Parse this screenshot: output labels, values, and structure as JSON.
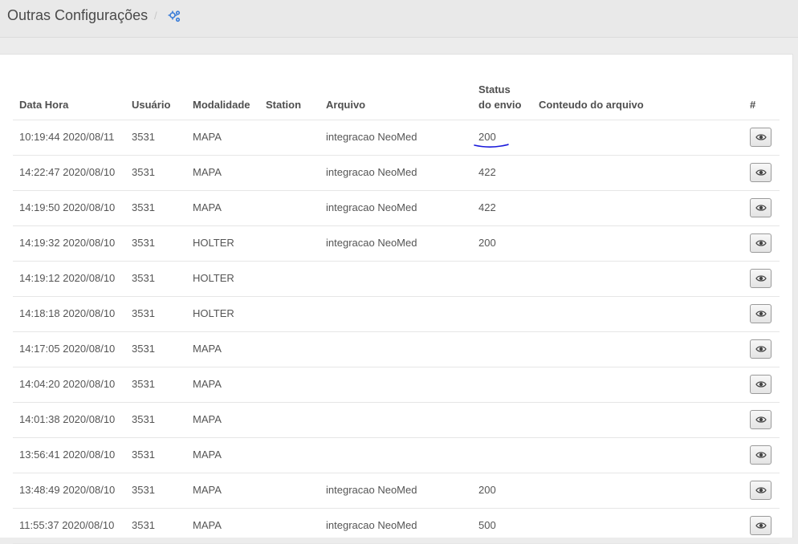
{
  "header": {
    "title": "Outras Configurações",
    "separator": "/",
    "icon": "cogs-icon"
  },
  "table": {
    "columns": {
      "data_hora": "Data Hora",
      "usuario": "Usuário",
      "modalidade": "Modalidade",
      "station": "Station",
      "arquivo": "Arquivo",
      "status_line1": "Status",
      "status_line2": "do envio",
      "conteudo": "Conteudo do arquivo",
      "acao": "#"
    },
    "rows": [
      {
        "data_hora": "10:19:44 2020/08/11",
        "usuario": "3531",
        "modalidade": "MAPA",
        "station": "",
        "arquivo": "integracao NeoMed",
        "status": "200",
        "conteudo": ""
      },
      {
        "data_hora": "14:22:47 2020/08/10",
        "usuario": "3531",
        "modalidade": "MAPA",
        "station": "",
        "arquivo": "integracao NeoMed",
        "status": "422",
        "conteudo": ""
      },
      {
        "data_hora": "14:19:50 2020/08/10",
        "usuario": "3531",
        "modalidade": "MAPA",
        "station": "",
        "arquivo": "integracao NeoMed",
        "status": "422",
        "conteudo": ""
      },
      {
        "data_hora": "14:19:32 2020/08/10",
        "usuario": "3531",
        "modalidade": "HOLTER",
        "station": "",
        "arquivo": "integracao NeoMed",
        "status": "200",
        "conteudo": ""
      },
      {
        "data_hora": "14:19:12 2020/08/10",
        "usuario": "3531",
        "modalidade": "HOLTER",
        "station": "",
        "arquivo": "",
        "status": "",
        "conteudo": ""
      },
      {
        "data_hora": "14:18:18 2020/08/10",
        "usuario": "3531",
        "modalidade": "HOLTER",
        "station": "",
        "arquivo": "",
        "status": "",
        "conteudo": ""
      },
      {
        "data_hora": "14:17:05 2020/08/10",
        "usuario": "3531",
        "modalidade": "MAPA",
        "station": "",
        "arquivo": "",
        "status": "",
        "conteudo": ""
      },
      {
        "data_hora": "14:04:20 2020/08/10",
        "usuario": "3531",
        "modalidade": "MAPA",
        "station": "",
        "arquivo": "",
        "status": "",
        "conteudo": ""
      },
      {
        "data_hora": "14:01:38 2020/08/10",
        "usuario": "3531",
        "modalidade": "MAPA",
        "station": "",
        "arquivo": "",
        "status": "",
        "conteudo": ""
      },
      {
        "data_hora": "13:56:41 2020/08/10",
        "usuario": "3531",
        "modalidade": "MAPA",
        "station": "",
        "arquivo": "",
        "status": "",
        "conteudo": ""
      },
      {
        "data_hora": "13:48:49 2020/08/10",
        "usuario": "3531",
        "modalidade": "MAPA",
        "station": "",
        "arquivo": "integracao NeoMed",
        "status": "200",
        "conteudo": ""
      },
      {
        "data_hora": "11:55:37 2020/08/10",
        "usuario": "3531",
        "modalidade": "MAPA",
        "station": "",
        "arquivo": "integracao NeoMed",
        "status": "500",
        "conteudo": ""
      }
    ],
    "row_action_icon": "eye-icon"
  },
  "colors": {
    "annotation": "#1a1adb",
    "link_icon": "#3b7dd8"
  }
}
